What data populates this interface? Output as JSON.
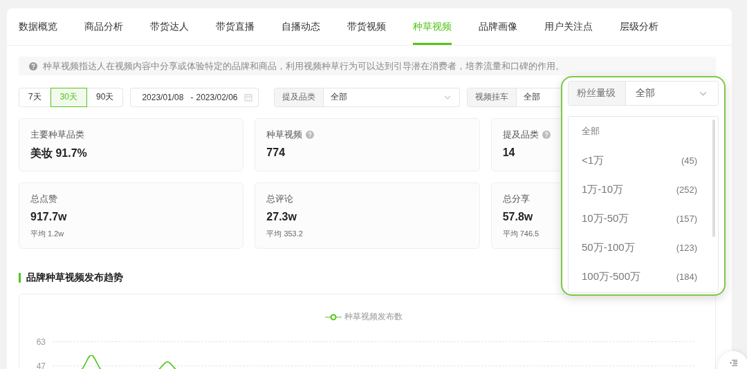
{
  "tabs": [
    {
      "label": "数据概览",
      "selected": false
    },
    {
      "label": "商品分析",
      "selected": false
    },
    {
      "label": "带货达人",
      "selected": false
    },
    {
      "label": "带货直播",
      "selected": false
    },
    {
      "label": "自播动态",
      "selected": false
    },
    {
      "label": "带货视频",
      "selected": false
    },
    {
      "label": "种草视频",
      "selected": true
    },
    {
      "label": "品牌画像",
      "selected": false
    },
    {
      "label": "用户关注点",
      "selected": false
    },
    {
      "label": "层级分析",
      "selected": false
    }
  ],
  "notice": "种草视频指达人在视频内容中分享或体验特定的品牌和商品，利用视频种草行为可以达到引导潜在消费者，培养流量和口碑的作用。",
  "periods": [
    {
      "label": "7天",
      "selected": false
    },
    {
      "label": "30天",
      "selected": true
    },
    {
      "label": "90天",
      "selected": false
    }
  ],
  "date_range": {
    "start": "2023/01/08",
    "separator": "-",
    "end": "2023/02/06"
  },
  "selects": [
    {
      "label": "提及品类",
      "value": "全部"
    },
    {
      "label": "视频挂车",
      "value": "全部"
    }
  ],
  "stats": [
    {
      "title": "主要种草品类",
      "value": "美妆 91.7%",
      "help": false
    },
    {
      "title": "种草视频",
      "value": "774",
      "help": true
    },
    {
      "title": "提及品类",
      "value": "14",
      "help": true
    },
    {
      "title": "总点赞",
      "value": "917.7w",
      "average": "平均 1.2w",
      "help": false
    },
    {
      "title": "总评论",
      "value": "27.3w",
      "average": "平均 353.2",
      "help": false
    },
    {
      "title": "总分享",
      "value": "57.8w",
      "average": "平均 746.5",
      "help": false
    }
  ],
  "trend": {
    "title": "品牌种草视频发布趋势",
    "legend": "种草视频发布数",
    "y_ticks": [
      "63",
      "47"
    ]
  },
  "fan_dropdown": {
    "label": "粉丝量级",
    "value": "全部",
    "options": [
      {
        "label": "全部"
      },
      {
        "label": "<1万",
        "count": "(45)"
      },
      {
        "label": "1万-10万",
        "count": "(252)"
      },
      {
        "label": "10万-50万",
        "count": "(157)"
      },
      {
        "label": "50万-100万",
        "count": "(123)"
      },
      {
        "label": "100万-500万",
        "count": "(184)"
      }
    ]
  }
}
